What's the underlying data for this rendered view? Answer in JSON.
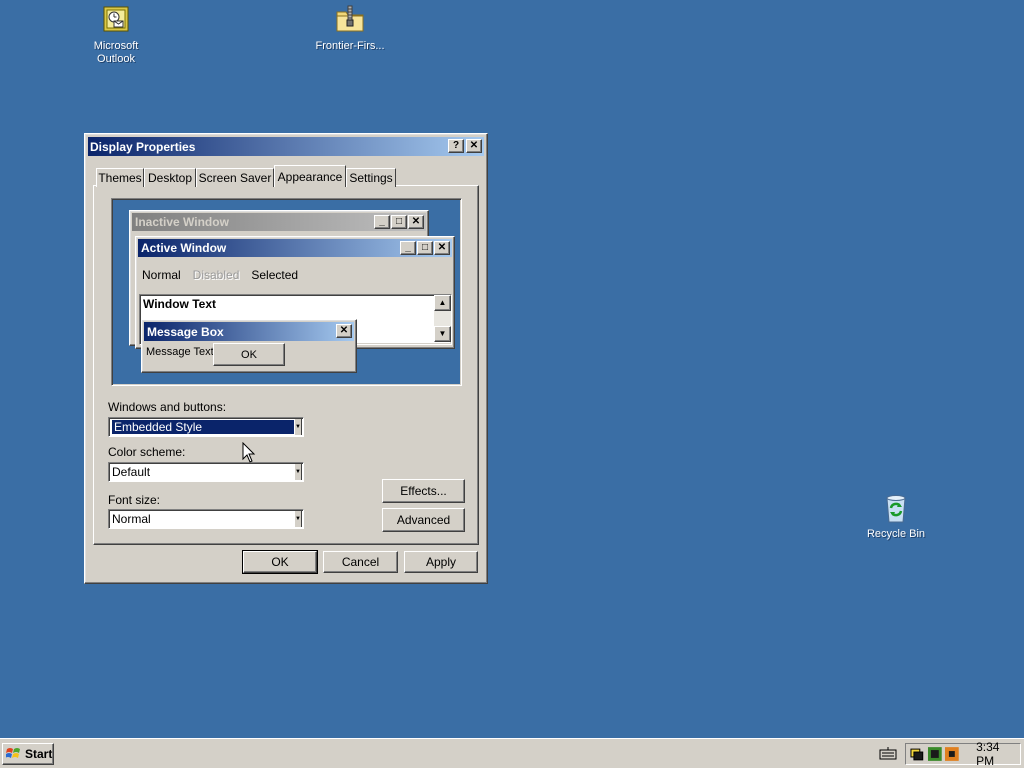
{
  "desktop": {
    "icons": [
      {
        "label_line1": "Microsoft",
        "label_line2": "Outlook"
      },
      {
        "label_line1": "Frontier-Firs...",
        "label_line2": ""
      },
      {
        "label_line1": "Recycle Bin",
        "label_line2": ""
      }
    ]
  },
  "dialog": {
    "title": "Display Properties",
    "help_glyph": "?",
    "close_glyph": "✕",
    "tabs": [
      {
        "label": "Themes"
      },
      {
        "label": "Desktop"
      },
      {
        "label": "Screen Saver"
      },
      {
        "label": "Appearance",
        "active": true
      },
      {
        "label": "Settings"
      }
    ],
    "preview": {
      "inactive_title": "Inactive Window",
      "active_title": "Active Window",
      "menu_normal": "Normal",
      "menu_disabled": "Disabled",
      "menu_selected": "Selected",
      "window_text": "Window Text",
      "msgbox_title": "Message Box",
      "msgbox_text": "Message Text",
      "msgbox_ok": "OK"
    },
    "windows_buttons_label": "Windows and buttons:",
    "windows_buttons_value": "Embedded Style",
    "color_scheme_label": "Color scheme:",
    "color_scheme_value": "Default",
    "font_size_label": "Font size:",
    "font_size_value": "Normal",
    "effects_button": "Effects...",
    "advanced_button": "Advanced",
    "ok_button": "OK",
    "cancel_button": "Cancel",
    "apply_button": "Apply"
  },
  "taskbar": {
    "start_label": "Start",
    "clock": "3:34 PM"
  },
  "colors": {
    "desktop": "#3a6ea5",
    "active_title_start": "#0a246a",
    "active_title_end": "#a6caf0",
    "inactive_title_start": "#808080",
    "inactive_title_end": "#c0c0c0",
    "selection": "#0a246a",
    "face": "#d4d0c8"
  }
}
